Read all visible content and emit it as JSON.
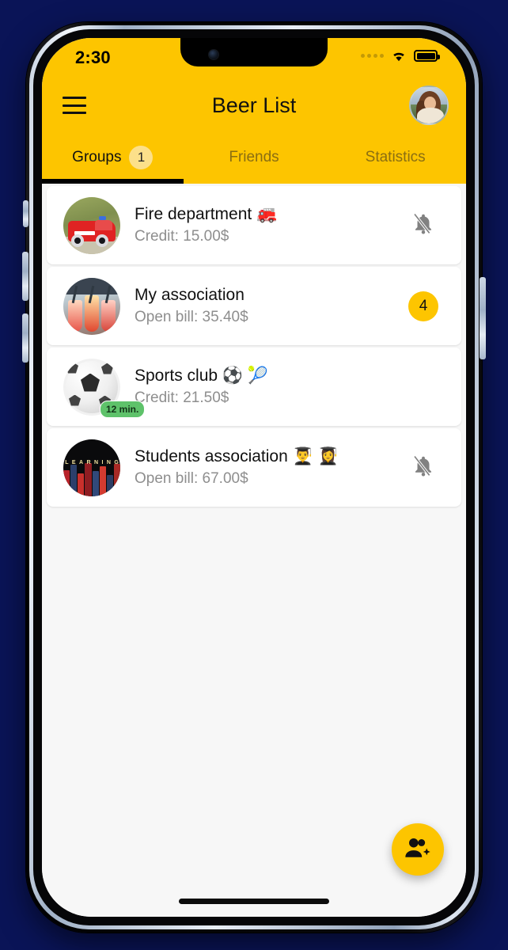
{
  "status_bar": {
    "time": "2:30",
    "signal_icon": "signal-dots-icon",
    "wifi_icon": "wifi-icon",
    "battery_icon": "battery-full-icon"
  },
  "header": {
    "menu_icon": "hamburger-menu-icon",
    "title": "Beer List",
    "avatar_icon": "profile-avatar"
  },
  "tabs": [
    {
      "label": "Groups",
      "badge": "1",
      "active": true
    },
    {
      "label": "Friends",
      "badge": null,
      "active": false
    },
    {
      "label": "Statistics",
      "badge": null,
      "active": false
    }
  ],
  "groups": [
    {
      "title": "Fire department 🚒",
      "subtitle": "Credit: 15.00$",
      "avatar": "fire-truck-avatar",
      "trailing_type": "bell-off-icon",
      "trailing_value": null,
      "time_badge": null
    },
    {
      "title": "My association",
      "subtitle": "Open bill: 35.40$",
      "avatar": "cocktail-drinks-avatar",
      "trailing_type": "count-badge",
      "trailing_value": "4",
      "time_badge": null
    },
    {
      "title": "Sports club ⚽ 🎾",
      "subtitle": "Credit: 21.50$",
      "avatar": "soccer-ball-avatar",
      "trailing_type": "none",
      "trailing_value": null,
      "time_badge": "12 min."
    },
    {
      "title": "Students association 👨‍🎓 👩‍🎓",
      "subtitle": "Open bill: 67.00$",
      "avatar": "books-shelf-avatar",
      "trailing_type": "bell-off-icon",
      "trailing_value": null,
      "time_badge": null
    }
  ],
  "fab": {
    "icon": "person-add-icon"
  },
  "colors": {
    "accent_yellow": "#FDC500",
    "badge_light_yellow": "#FCE08A",
    "green_badge": "#5EC26A",
    "page_background": "#0a1457",
    "list_background": "#f7f7f7",
    "card_background": "#ffffff",
    "subtitle_gray": "#8e8e8e",
    "inactive_tab": "#8a6e12"
  }
}
